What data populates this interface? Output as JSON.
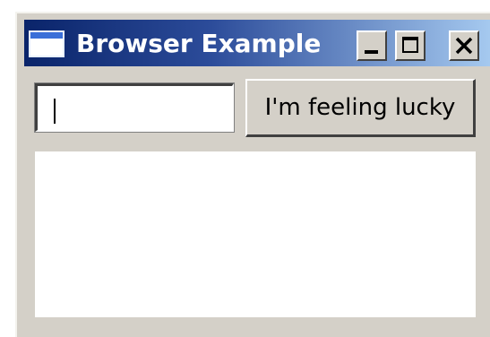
{
  "window": {
    "title": "Browser Example"
  },
  "titlebar_buttons": {
    "minimize_icon": "minimize-icon",
    "maximize_icon": "maximize-icon",
    "close_icon": "close-icon"
  },
  "toolbar": {
    "search_value": "",
    "lucky_label": "I'm feeling lucky"
  },
  "browser": {
    "content": ""
  }
}
